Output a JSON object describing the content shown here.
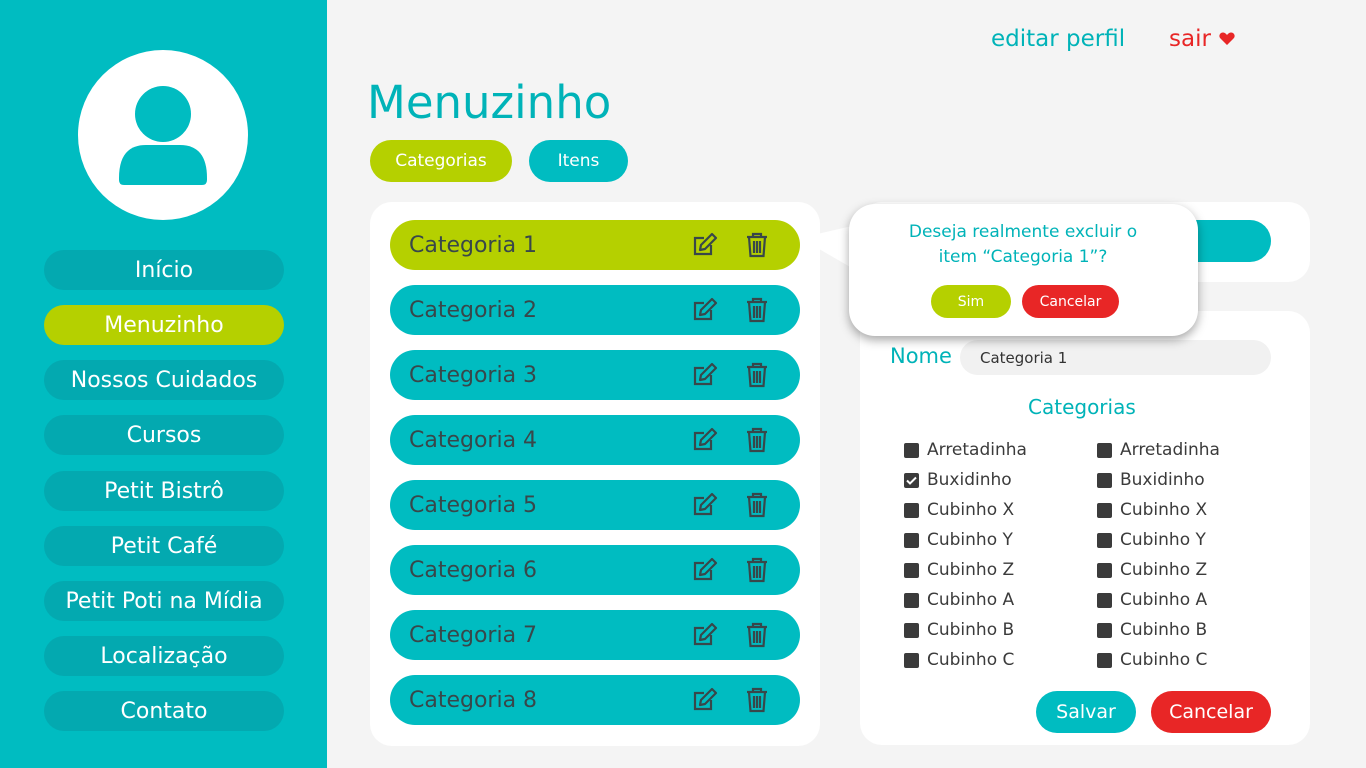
{
  "sidebar": {
    "avatar_icon": "user-icon",
    "items": [
      {
        "label": "Início",
        "active": false
      },
      {
        "label": "Menuzinho",
        "active": true
      },
      {
        "label": "Nossos Cuidados",
        "active": false
      },
      {
        "label": "Cursos",
        "active": false
      },
      {
        "label": "Petit Bistrô",
        "active": false
      },
      {
        "label": "Petit Café",
        "active": false
      },
      {
        "label": "Petit Poti na Mídia",
        "active": false
      },
      {
        "label": "Localização",
        "active": false
      },
      {
        "label": "Contato",
        "active": false
      }
    ]
  },
  "header": {
    "edit_profile": "editar perfil",
    "logout": "sair",
    "logout_icon": "heart-icon"
  },
  "page": {
    "title": "Menuzinho",
    "tabs": [
      {
        "label": "Categorias",
        "active": true
      },
      {
        "label": "Itens",
        "active": false
      }
    ]
  },
  "categories": {
    "edit_icon": "edit-icon",
    "delete_icon": "trash-icon",
    "rows": [
      {
        "label": "Categoria 1",
        "active": true
      },
      {
        "label": "Categoria 2",
        "active": false
      },
      {
        "label": "Categoria 3",
        "active": false
      },
      {
        "label": "Categoria 4",
        "active": false
      },
      {
        "label": "Categoria 5",
        "active": false
      },
      {
        "label": "Categoria 6",
        "active": false
      },
      {
        "label": "Categoria 7",
        "active": false
      },
      {
        "label": "Categoria 8",
        "active": false
      }
    ]
  },
  "form": {
    "name_label": "Nome",
    "name_value": "Categoria 1",
    "categories_title": "Categorias",
    "checklist_left": [
      {
        "label": "Arretadinha",
        "checked": false
      },
      {
        "label": "Buxidinho",
        "checked": true
      },
      {
        "label": "Cubinho X",
        "checked": false
      },
      {
        "label": "Cubinho Y",
        "checked": false
      },
      {
        "label": "Cubinho Z",
        "checked": false
      },
      {
        "label": "Cubinho A",
        "checked": false
      },
      {
        "label": "Cubinho B",
        "checked": false
      },
      {
        "label": "Cubinho C",
        "checked": false
      }
    ],
    "checklist_right": [
      {
        "label": "Arretadinha",
        "checked": false
      },
      {
        "label": "Buxidinho",
        "checked": false
      },
      {
        "label": "Cubinho X",
        "checked": false
      },
      {
        "label": "Cubinho Y",
        "checked": false
      },
      {
        "label": "Cubinho Z",
        "checked": false
      },
      {
        "label": "Cubinho A",
        "checked": false
      },
      {
        "label": "Cubinho B",
        "checked": false
      },
      {
        "label": "Cubinho C",
        "checked": false
      }
    ],
    "save_label": "Salvar",
    "cancel_label": "Cancelar"
  },
  "popup": {
    "line1": "Deseja realmente excluir o",
    "line2": "item “Categoria 1”?",
    "yes_label": "Sim",
    "no_label": "Cancelar"
  },
  "colors": {
    "teal": "#00bcc1",
    "teal_dark": "#03a9b0",
    "lime": "#b5d000",
    "red": "#e82626"
  }
}
